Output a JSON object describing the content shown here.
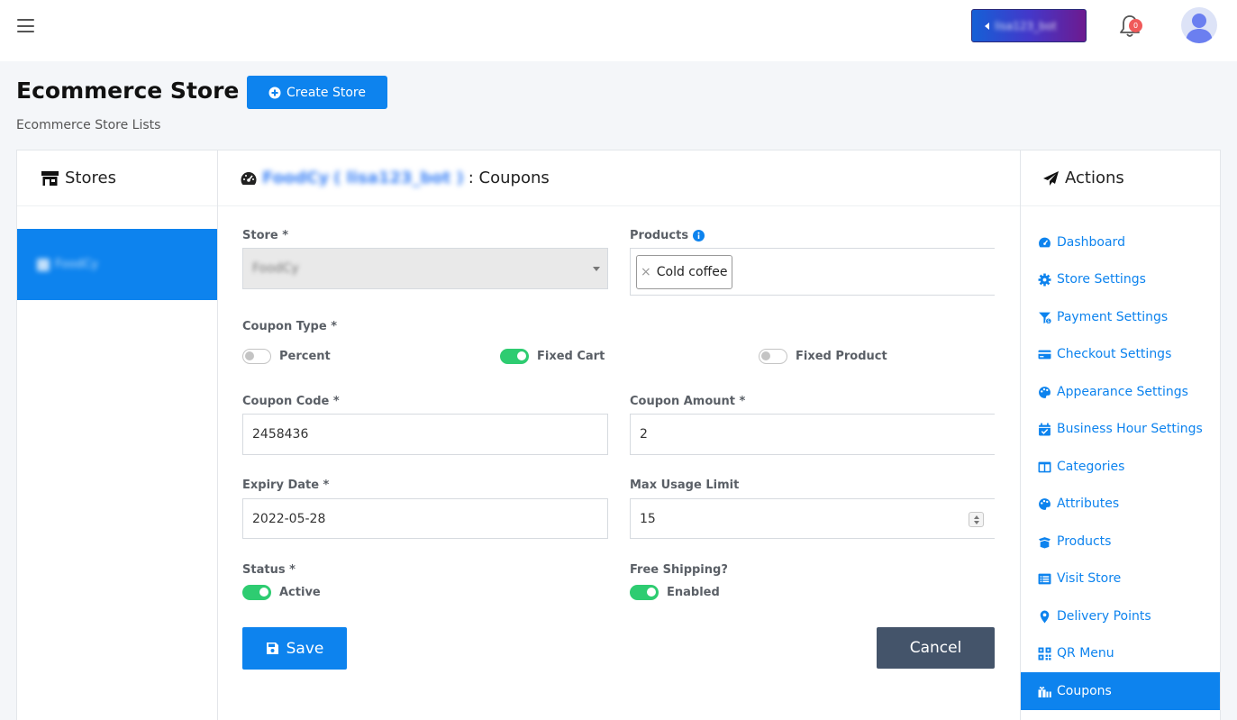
{
  "topbar": {
    "bot_label": "lisa123_bot",
    "notification_count": "0"
  },
  "header": {
    "title": "Ecommerce Store",
    "create_label": "Create Store",
    "subtitle": "Ecommerce Store Lists"
  },
  "stores": {
    "heading": "Stores",
    "items": [
      {
        "label": "FoodCy"
      }
    ]
  },
  "main": {
    "store_name": "FoodCy",
    "store_bot": "( lisa123_bot )",
    "heading_suffix": ": Coupons"
  },
  "form": {
    "store_label": "Store *",
    "store_value": "FoodCy",
    "products_label": "Products",
    "products": [
      "Cold coffee"
    ],
    "coupon_type_label": "Coupon Type *",
    "coupon_types": [
      {
        "label": "Percent",
        "on": false
      },
      {
        "label": "Fixed Cart",
        "on": true
      },
      {
        "label": "Fixed Product",
        "on": false
      }
    ],
    "code_label": "Coupon Code *",
    "code_value": "2458436",
    "amount_label": "Coupon Amount *",
    "amount_value": "2",
    "expiry_label": "Expiry Date *",
    "expiry_value": "2022-05-28",
    "max_usage_label": "Max Usage Limit",
    "max_usage_value": "15",
    "status_label": "Status *",
    "status_value": "Active",
    "shipping_label": "Free Shipping?",
    "shipping_value": "Enabled",
    "save_label": "Save",
    "cancel_label": "Cancel"
  },
  "actions": {
    "heading": "Actions",
    "items": [
      {
        "label": "Dashboard",
        "icon": "tachometer-icon"
      },
      {
        "label": "Store Settings",
        "icon": "gear-icon"
      },
      {
        "label": "Payment Settings",
        "icon": "funnel-dollar-icon"
      },
      {
        "label": "Checkout Settings",
        "icon": "credit-card-icon"
      },
      {
        "label": "Appearance Settings",
        "icon": "palette-icon"
      },
      {
        "label": "Business Hour Settings",
        "icon": "calendar-check-icon"
      },
      {
        "label": "Categories",
        "icon": "columns-icon"
      },
      {
        "label": "Attributes",
        "icon": "palette-icon"
      },
      {
        "label": "Products",
        "icon": "box-open-icon"
      },
      {
        "label": "Visit Store",
        "icon": "list-alt-icon"
      },
      {
        "label": "Delivery Points",
        "icon": "map-marker-icon"
      },
      {
        "label": "QR Menu",
        "icon": "qrcode-icon"
      },
      {
        "label": "Coupons",
        "icon": "gifts-icon",
        "active": true
      }
    ]
  },
  "colors": {
    "primary": "#0d83ee",
    "success": "#2ecc71",
    "secondary": "#44546a",
    "badge": "#f05a5a"
  }
}
